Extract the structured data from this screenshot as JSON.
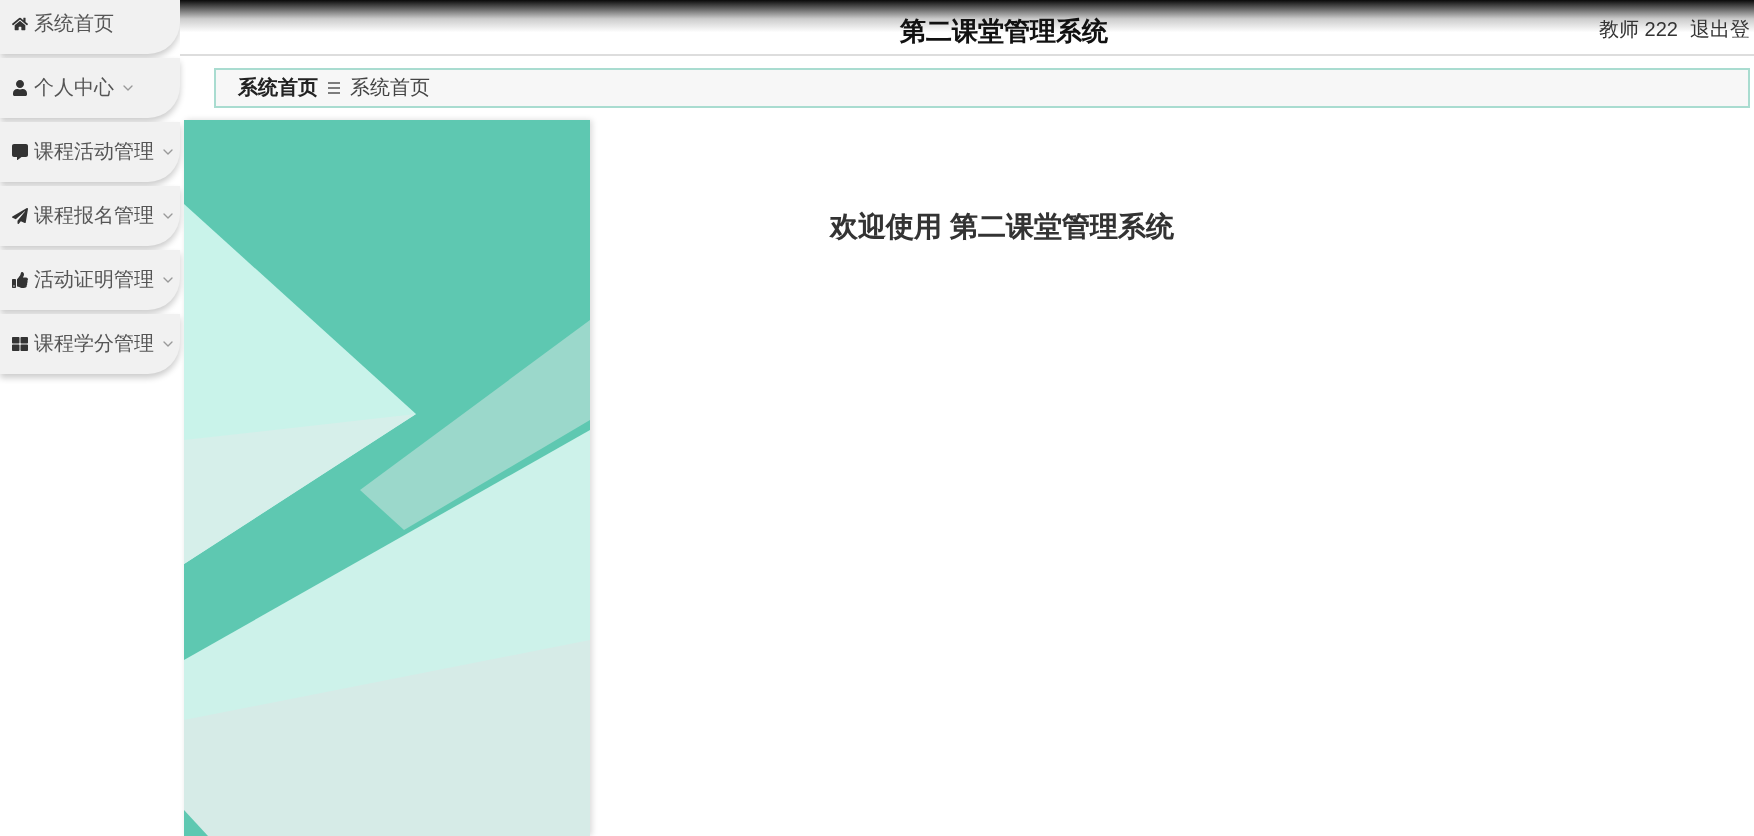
{
  "header": {
    "title": "第二课堂管理系统",
    "user": "教师 222",
    "logout": "退出登"
  },
  "sidebar": {
    "items": [
      {
        "label": "系统首页",
        "expandable": false
      },
      {
        "label": "个人中心",
        "expandable": true
      },
      {
        "label": "课程活动管理",
        "expandable": true
      },
      {
        "label": "课程报名管理",
        "expandable": true
      },
      {
        "label": "活动证明管理",
        "expandable": true
      },
      {
        "label": "课程学分管理",
        "expandable": true
      }
    ]
  },
  "breadcrumb": [
    "系统首页",
    "系统首页"
  ],
  "welcome": "欢迎使用 第二课堂管理系统"
}
